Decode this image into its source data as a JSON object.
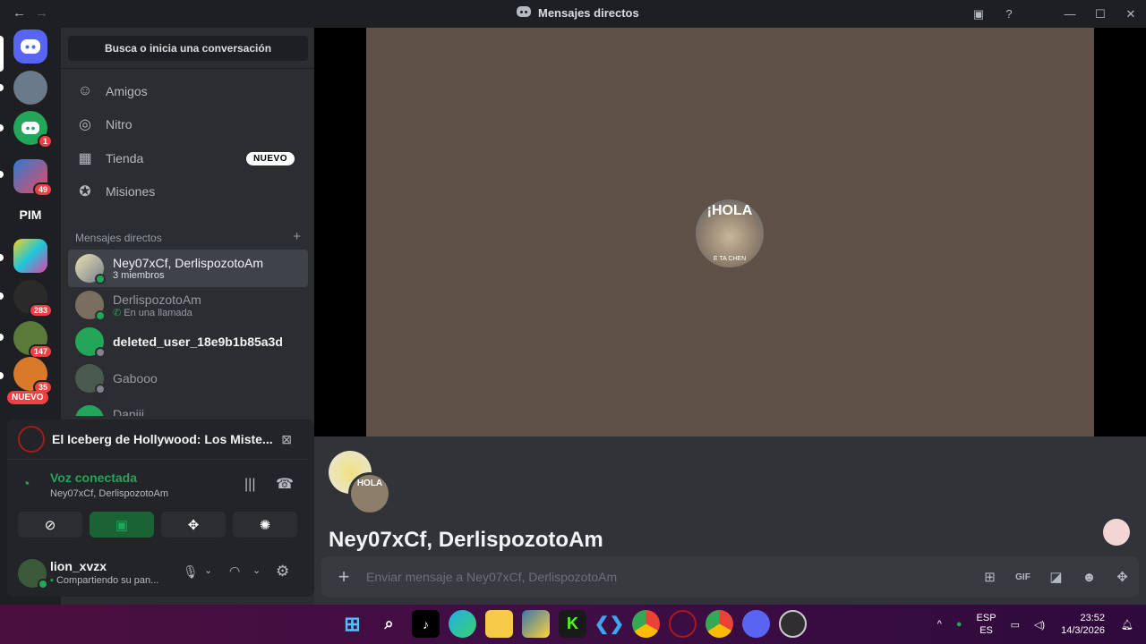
{
  "window": {
    "title": "Mensajes directos"
  },
  "guilds": {
    "items": [
      {
        "label": "",
        "badge": ""
      },
      {
        "label": "",
        "badge": ""
      },
      {
        "label": "",
        "badge": "1"
      },
      {
        "label": "",
        "badge": "49"
      },
      {
        "label": "PIM",
        "badge": ""
      },
      {
        "label": "",
        "badge": ""
      },
      {
        "label": "",
        "badge": "283"
      },
      {
        "label": "",
        "badge": "147"
      },
      {
        "label": "",
        "badge": "35"
      }
    ],
    "nuevo": "NUEVO"
  },
  "sidebar": {
    "search": "Busca o inicia una conversación",
    "nav": [
      {
        "label": "Amigos",
        "icon": "friends-icon"
      },
      {
        "label": "Nitro",
        "icon": "nitro-icon"
      },
      {
        "label": "Tienda",
        "icon": "shop-icon",
        "badge": "NUEVO"
      },
      {
        "label": "Misiones",
        "icon": "quests-icon"
      }
    ],
    "dm_header": "Mensajes directos",
    "dms": [
      {
        "name": "Ney07xCf, DerlispozotoAm",
        "sub": "3 miembros"
      },
      {
        "name": "DerlispozotoAm",
        "sub": "En una llamada"
      },
      {
        "name": "deleted_user_18e9b1b85a3d",
        "sub": ""
      },
      {
        "name": "Gabooo",
        "sub": ""
      },
      {
        "name": "Daniii",
        "sub": ""
      }
    ]
  },
  "panel": {
    "stream_title": "El Iceberg de Hollywood: Los Miste...",
    "voice_status": "Voz conectada",
    "voice_channel": "Ney07xCf, DerlispozotoAm",
    "username": "lion_xvzx",
    "user_status": "Compartiendo su pan..."
  },
  "call": {
    "avatar_text": "¡HOLA",
    "avatar_sub": "E TA CHEN"
  },
  "chat": {
    "title": "Ney07xCf, DerlispozotoAm",
    "placeholder": "Enviar mensaje a Ney07xCf, DerlispozotoAm",
    "avatar_text": "HOLA"
  },
  "taskbar": {
    "lang": "ESP",
    "lang2": "ES",
    "time": "23:52",
    "date": "14/3/2026"
  }
}
